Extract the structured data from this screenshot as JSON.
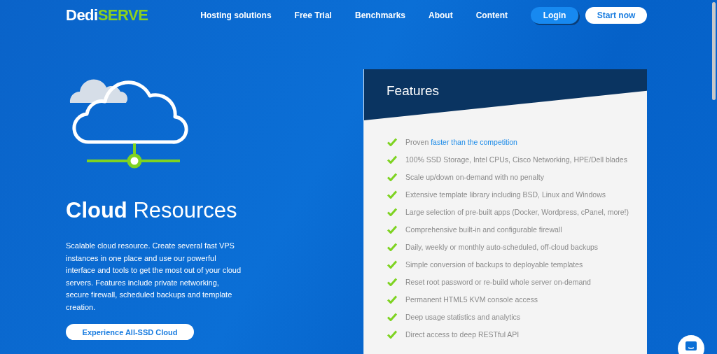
{
  "logo": {
    "first": "Dedi",
    "second": "SERVE"
  },
  "nav": [
    "Hosting solutions",
    "Free Trial",
    "Benchmarks",
    "About",
    "Content"
  ],
  "login_button": "Login",
  "start_button": "Start now",
  "hero": {
    "title": "**Cloud** Resources",
    "description": "Scalable cloud resource. Create several fast VPS instances in one place and use our powerful interface and tools to get the most out of your cloud servers. Features include private networking, secure firewall, scheduled backups and template creation.",
    "cta": "Experience All-SSD Cloud"
  },
  "features": {
    "title": "Features",
    "items": [
      {
        "text": "Proven ",
        "link": "faster than the competition"
      },
      {
        "text": "100% SSD Storage, Intel CPUs, Cisco Networking, HPE/Dell blades"
      },
      {
        "text": "Scale up/down on-demand with no penalty"
      },
      {
        "text": "Extensive template library including BSD, Linux and Windows"
      },
      {
        "text": "Large selection of pre-built apps (Docker, Wordpress, cPanel, more!)"
      },
      {
        "text": "Comprehensive built-in and configurable firewall"
      },
      {
        "text": "Daily, weekly or monthly auto-scheduled, off-cloud backups"
      },
      {
        "text": "Simple conversion of backups to deployable templates"
      },
      {
        "text": "Reset root password or re-build whole server on-demand"
      },
      {
        "text": "Permanent HTML5 KVM console access"
      },
      {
        "text": "Deep usage statistics and analytics"
      },
      {
        "text": "Direct access to deep RESTful API"
      }
    ]
  }
}
